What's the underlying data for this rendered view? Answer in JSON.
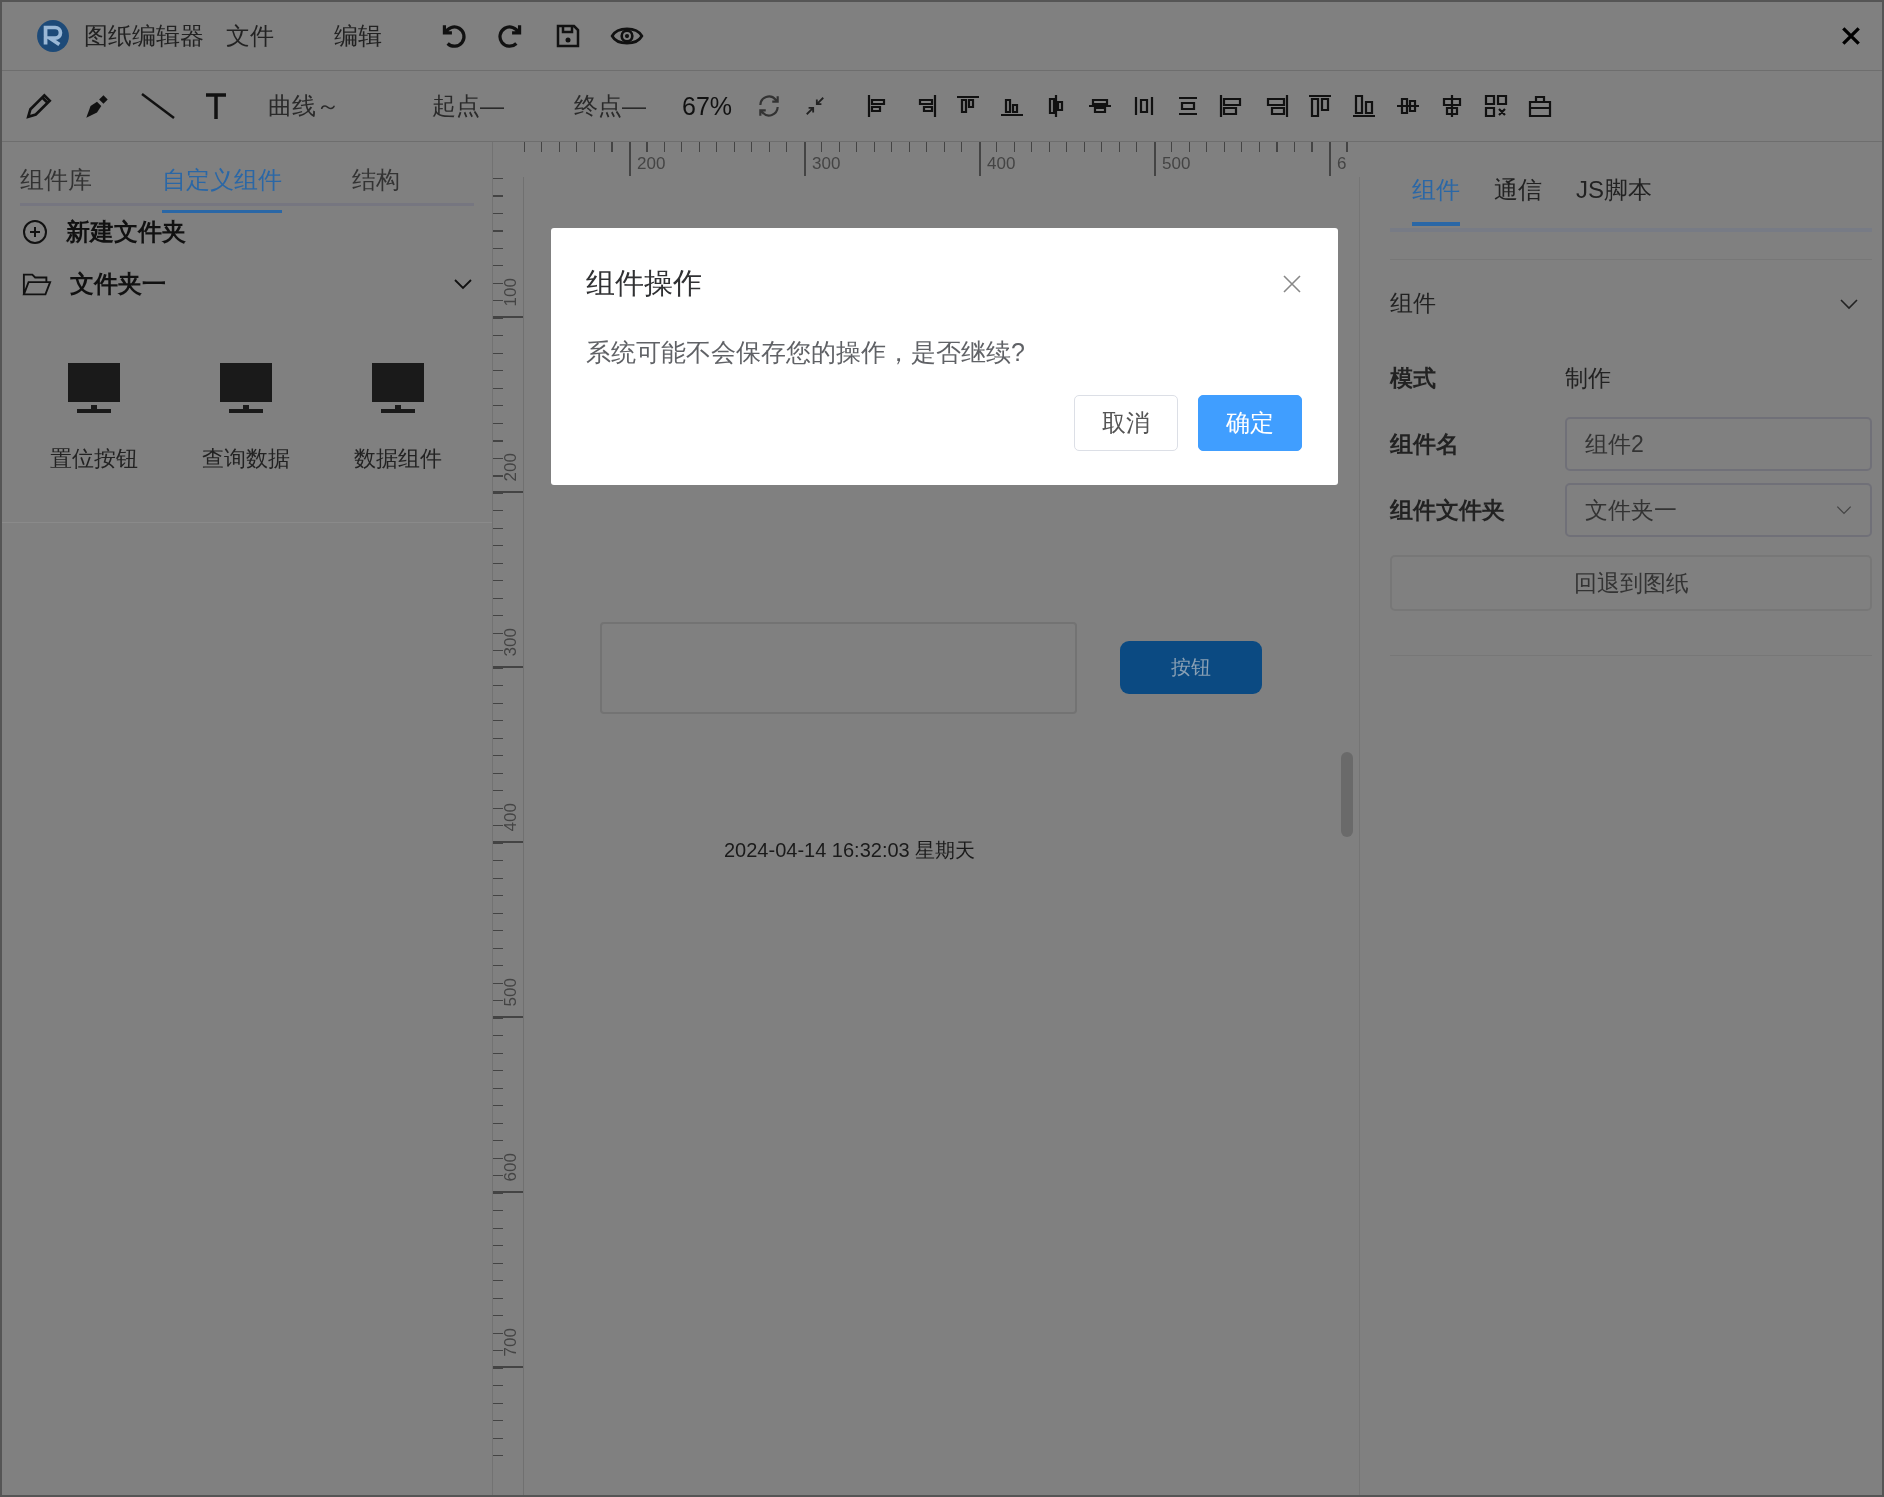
{
  "app": {
    "title": "图纸编辑器"
  },
  "menu": [
    {
      "label": "文件"
    },
    {
      "label": "编辑"
    }
  ],
  "toolbar": {
    "curve": "曲线～",
    "start": "起点—",
    "end": "终点—",
    "zoom": "67%"
  },
  "left_panel": {
    "tabs": [
      {
        "label": "组件库",
        "selected": false
      },
      {
        "label": "自定义组件",
        "selected": true
      },
      {
        "label": "结构",
        "selected": false
      }
    ],
    "new_folder": "新建文件夹",
    "folder": {
      "name": "文件夹一",
      "expanded": true,
      "items": [
        "置位按钮",
        "查询数据",
        "数据组件"
      ]
    }
  },
  "ruler": {
    "x_labels": [
      "200",
      "300",
      "400",
      "500",
      "6"
    ],
    "y_labels": [
      "100",
      "200",
      "300",
      "400",
      "500",
      "600",
      "700"
    ]
  },
  "canvas": {
    "button": "按钮",
    "datetime": "2024-04-14 16:32:03 星期天"
  },
  "right_panel": {
    "tabs": [
      {
        "label": "组件",
        "selected": true
      },
      {
        "label": "通信",
        "selected": false
      },
      {
        "label": "JS脚本",
        "selected": false
      }
    ],
    "section": {
      "title": "组件",
      "expanded": true
    },
    "fields": [
      {
        "label": "模式",
        "kind": "text",
        "value": "制作"
      },
      {
        "label": "组件名",
        "kind": "input",
        "value": "组件2"
      },
      {
        "label": "组件文件夹",
        "kind": "select",
        "value": "文件夹一"
      }
    ],
    "back_button": "回退到图纸"
  },
  "dialog": {
    "title": "组件操作",
    "message": "系统可能不会保存您的操作，是否继续?",
    "buttons": [
      {
        "label": "取消",
        "kind": "default"
      },
      {
        "label": "确定",
        "kind": "primary"
      }
    ]
  }
}
